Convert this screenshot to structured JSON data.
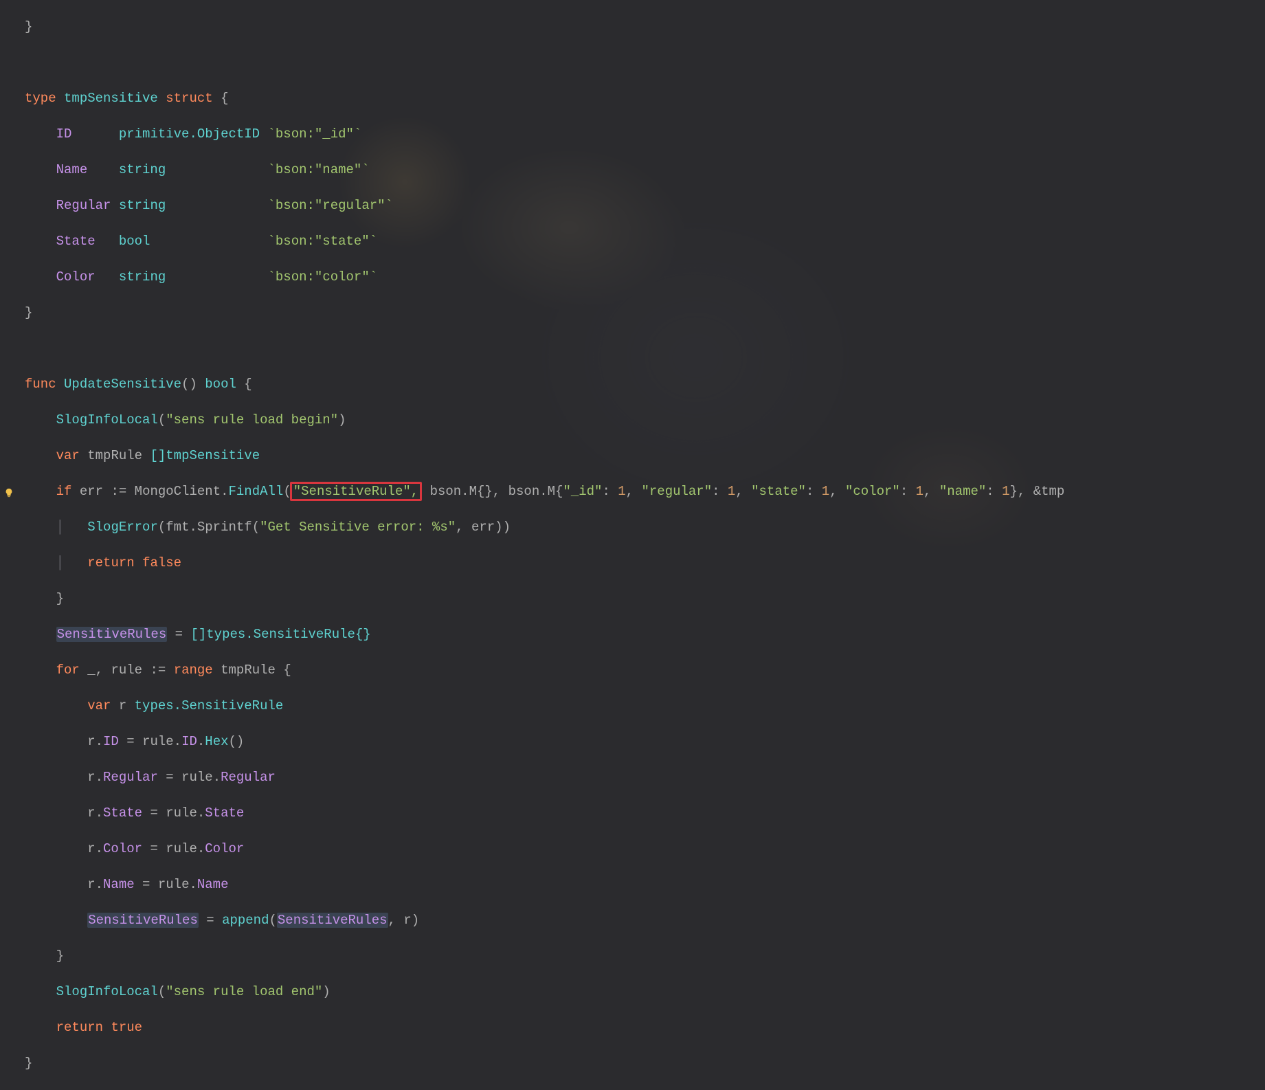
{
  "code": {
    "close_brace_top": "}",
    "type_kw": "type",
    "struct_name": "tmpSensitive",
    "struct_kw": "struct",
    "open_brace": "{",
    "fields": {
      "id": {
        "name": "ID",
        "type": "primitive.ObjectID",
        "tag": "`bson:\"_id\"`"
      },
      "name": {
        "name": "Name",
        "type": "string",
        "tag": "`bson:\"name\"`"
      },
      "regular": {
        "name": "Regular",
        "type": "string",
        "tag": "`bson:\"regular\"`"
      },
      "state": {
        "name": "State",
        "type": "bool",
        "tag": "`bson:\"state\"`"
      },
      "color": {
        "name": "Color",
        "type": "string",
        "tag": "`bson:\"color\"`"
      }
    },
    "close_brace_struct": "}",
    "func_kw": "func",
    "func_name": "UpdateSensitive",
    "func_ret": "bool",
    "slog_begin_call": "SlogInfoLocal",
    "slog_begin_arg": "\"sens rule load begin\"",
    "var_kw": "var",
    "tmpRule": "tmpRule",
    "tmpRule_type": "[]tmpSensitive",
    "if_kw": "if",
    "err": "err",
    "assign": ":=",
    "mongo_client": "MongoClient",
    "find_all": "FindAll",
    "find_all_arg1_boxed": "\"SensitiveRule\",",
    "bson_m1": "bson.M{}",
    "bson_m2_open": "bson.M{",
    "proj_id": "\"_id\": 1",
    "proj_regular": "\"regular\": 1",
    "proj_state": "\"state\": 1",
    "proj_color": "\"color\": 1",
    "proj_name": "\"name\": 1",
    "bson_m2_close": "}",
    "tail_amp": ", &tmp",
    "slog_error": "SlogError",
    "fmt_sprintf": "fmt.Sprintf",
    "sprintf_fmt": "\"Get Sensitive error: %s\"",
    "sprintf_arg": "err",
    "return_kw": "return",
    "false_kw": "false",
    "sensitiveRules": "SensitiveRules",
    "types_sensRule": "[]types.SensitiveRule{}",
    "for_kw": "for",
    "range_kw": "range",
    "underscore": "_",
    "rule": "rule",
    "r": "r",
    "r_type": "types.SensitiveRule",
    "assign_eq": "=",
    "hex": "Hex",
    "append": "append",
    "slog_end_call": "SlogInfoLocal",
    "slog_end_arg": "\"sens rule load end\"",
    "true_kw": "true"
  },
  "icons": {
    "bulb": "lightbulb"
  }
}
